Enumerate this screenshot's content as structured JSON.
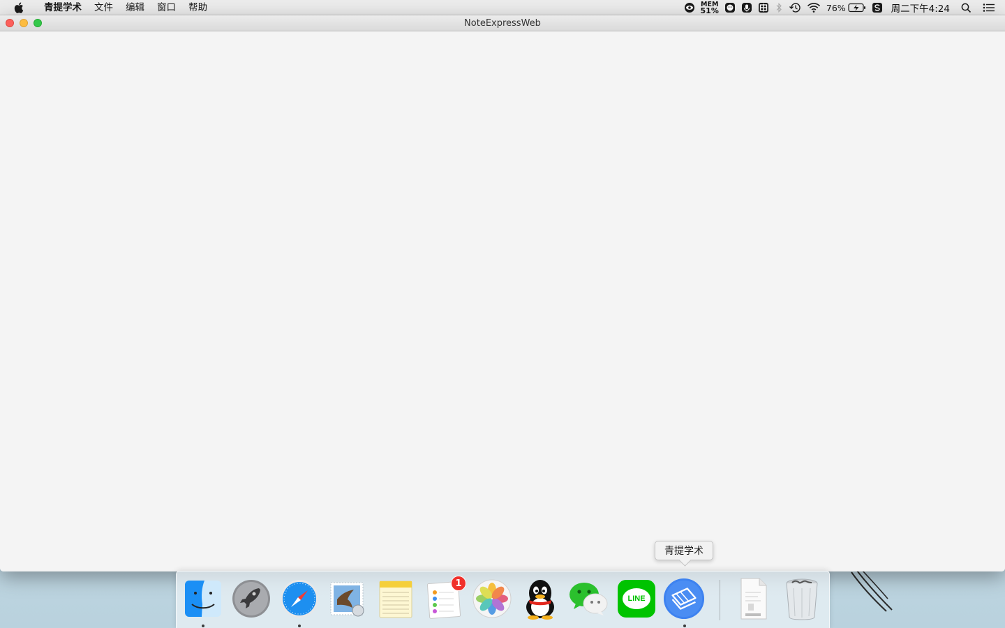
{
  "menubar": {
    "apple_icon": "apple-icon",
    "app_name": "青提学术",
    "items": [
      "文件",
      "编辑",
      "窗口",
      "帮助"
    ],
    "status": {
      "mem_label": "MEM",
      "mem_value": "51%",
      "battery_percent": "76%",
      "clock": "周二下午4:24"
    }
  },
  "window": {
    "title": "NoteExpressWeb"
  },
  "dock": {
    "tooltip": "青提学术",
    "items": [
      {
        "name": "Finder",
        "icon": "finder-icon",
        "running": true
      },
      {
        "name": "Launchpad",
        "icon": "launchpad-icon",
        "running": false
      },
      {
        "name": "Safari",
        "icon": "safari-icon",
        "running": true
      },
      {
        "name": "Mail",
        "icon": "mail-icon",
        "running": false
      },
      {
        "name": "Notes",
        "icon": "notes-icon",
        "running": false
      },
      {
        "name": "Reminders",
        "icon": "reminders-icon",
        "running": false,
        "badge": "1"
      },
      {
        "name": "Photos",
        "icon": "photos-icon",
        "running": false
      },
      {
        "name": "QQ",
        "icon": "qq-icon",
        "running": false
      },
      {
        "name": "WeChat",
        "icon": "wechat-icon",
        "running": false
      },
      {
        "name": "LINE",
        "icon": "line-icon",
        "running": false,
        "label": "LINE"
      },
      {
        "name": "青提学术",
        "icon": "qingti-icon",
        "running": true
      },
      {
        "name": "Document",
        "icon": "document-icon",
        "running": false
      },
      {
        "name": "Trash",
        "icon": "trash-icon",
        "running": false
      }
    ]
  },
  "colors": {
    "close": "#fc605c",
    "minimize": "#fdbc40",
    "maximize": "#34c84a",
    "badge": "#f0302b",
    "line_green": "#00c300",
    "qingti_blue": "#3d82f0"
  }
}
